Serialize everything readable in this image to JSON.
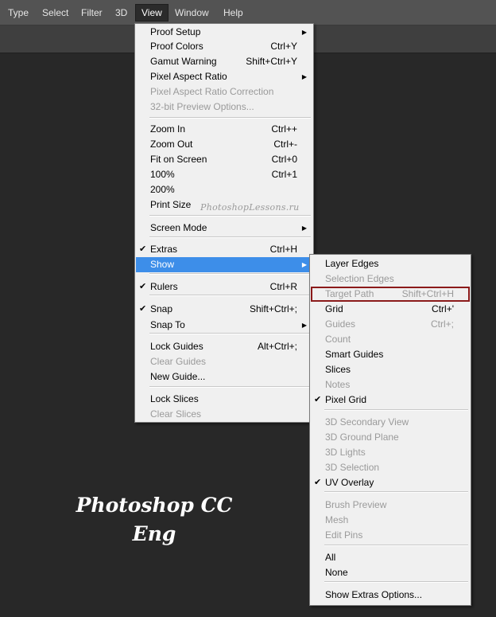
{
  "menubar": {
    "items": [
      "Type",
      "Select",
      "Filter",
      "3D",
      "View",
      "Window",
      "Help"
    ]
  },
  "view_menu": {
    "items": [
      {
        "label": "Proof Setup",
        "submenu": true
      },
      {
        "label": "Proof Colors",
        "shortcut": "Ctrl+Y"
      },
      {
        "label": "Gamut Warning",
        "shortcut": "Shift+Ctrl+Y"
      },
      {
        "label": "Pixel Aspect Ratio",
        "submenu": true
      },
      {
        "label": "Pixel Aspect Ratio Correction",
        "disabled": true
      },
      {
        "label": "32-bit Preview Options...",
        "disabled": true
      },
      {
        "label": "Zoom In",
        "shortcut": "Ctrl++"
      },
      {
        "label": "Zoom Out",
        "shortcut": "Ctrl+-"
      },
      {
        "label": "Fit on Screen",
        "shortcut": "Ctrl+0"
      },
      {
        "label": "100%",
        "shortcut": "Ctrl+1"
      },
      {
        "label": "200%"
      },
      {
        "label": "Print Size"
      },
      {
        "label": "Screen Mode",
        "submenu": true
      },
      {
        "label": "Extras",
        "shortcut": "Ctrl+H",
        "checked": true
      },
      {
        "label": "Show",
        "submenu": true,
        "highlighted": true
      },
      {
        "label": "Rulers",
        "shortcut": "Ctrl+R",
        "checked": true
      },
      {
        "label": "Snap",
        "shortcut": "Shift+Ctrl+;",
        "checked": true
      },
      {
        "label": "Snap To",
        "submenu": true
      },
      {
        "label": "Lock Guides",
        "shortcut": "Alt+Ctrl+;"
      },
      {
        "label": "Clear Guides",
        "disabled": true
      },
      {
        "label": "New Guide..."
      },
      {
        "label": "Lock Slices"
      },
      {
        "label": "Clear Slices",
        "disabled": true
      }
    ]
  },
  "show_menu": {
    "items": [
      {
        "label": "Layer Edges"
      },
      {
        "label": "Selection Edges",
        "disabled": true
      },
      {
        "label": "Target Path",
        "shortcut": "Shift+Ctrl+H",
        "disabled": true,
        "outlined": true
      },
      {
        "label": "Grid",
        "shortcut": "Ctrl+'"
      },
      {
        "label": "Guides",
        "shortcut": "Ctrl+;",
        "disabled": true
      },
      {
        "label": "Count",
        "disabled": true
      },
      {
        "label": "Smart Guides"
      },
      {
        "label": "Slices"
      },
      {
        "label": "Notes",
        "disabled": true
      },
      {
        "label": "Pixel Grid",
        "checked": true
      },
      {
        "label": "3D Secondary View",
        "disabled": true
      },
      {
        "label": "3D Ground Plane",
        "disabled": true
      },
      {
        "label": "3D Lights",
        "disabled": true
      },
      {
        "label": "3D Selection",
        "disabled": true
      },
      {
        "label": "UV Overlay",
        "checked": true
      },
      {
        "label": "Brush Preview",
        "disabled": true
      },
      {
        "label": "Mesh",
        "disabled": true
      },
      {
        "label": "Edit Pins",
        "disabled": true
      },
      {
        "label": "All"
      },
      {
        "label": "None"
      },
      {
        "label": "Show Extras Options..."
      }
    ]
  },
  "watermark": "PhotoshopLessons.ru",
  "brand": {
    "line1": "Photoshop  CC",
    "line2": "Eng"
  },
  "colors": {
    "highlight": "#3d8ee9",
    "outline": "#8b1a1a",
    "canvas": "#282828"
  }
}
